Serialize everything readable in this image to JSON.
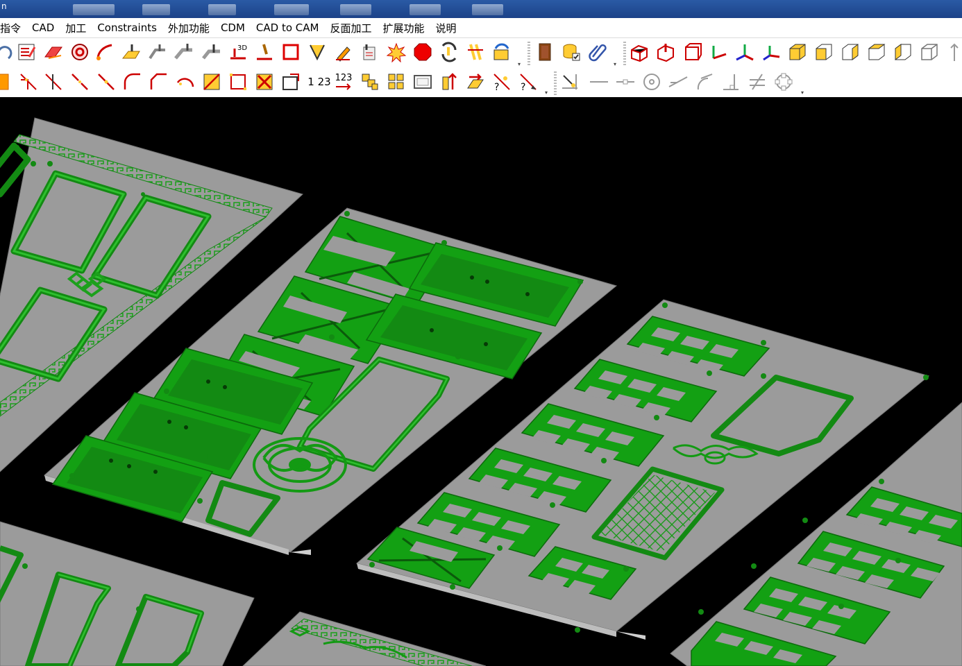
{
  "taskbar": {
    "corner_text": "n"
  },
  "menu": {
    "items": [
      {
        "label": "指令"
      },
      {
        "label": "CAD"
      },
      {
        "label": "加工"
      },
      {
        "label": "Constraints"
      },
      {
        "label": "外加功能"
      },
      {
        "label": "CDM"
      },
      {
        "label": "CAD to CAM"
      },
      {
        "label": "反面加工"
      },
      {
        "label": "扩展功能"
      },
      {
        "label": "说明"
      }
    ]
  },
  "toolbar2": {
    "num_label_1": "1 23",
    "num_label_2": "123"
  },
  "colors": {
    "panel_gray": "#9a9a9a",
    "carving_green": "#138a13",
    "highlight_green": "#2ec02e",
    "background": "#000000",
    "title_bar": "#1c4288"
  }
}
